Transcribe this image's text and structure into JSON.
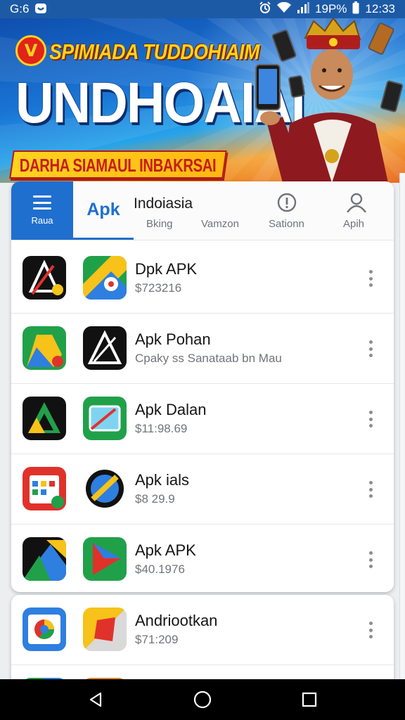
{
  "status_bar": {
    "time_left": "G:6",
    "battery": "19P%",
    "clock": "12:33"
  },
  "banner": {
    "headline_top": "SPIMIADA TUDDOHIAIM",
    "headline_big": "UNDHOAIAI",
    "ribbon_text": "DARHA SIAMAUL INBAKRSAI",
    "logo_letter": "V"
  },
  "tabs": {
    "menu_label": "Raua",
    "apk_label": "Apk",
    "title": "Indoiasia",
    "labels": [
      "Bking",
      "Vamzon",
      "Sationn",
      "Apih"
    ]
  },
  "apps": [
    {
      "title": "Dpk APK",
      "subtitle": "$723216",
      "icon1": "arrow-black-icon",
      "icon2": "maps-green-icon"
    },
    {
      "title": "Apk Pohan",
      "subtitle": "Cpaky ss Sanataab bn Mau",
      "icon1": "drive-green-icon",
      "icon2": "arrow-black-icon"
    },
    {
      "title": "Apk Dalan",
      "subtitle": "$11:98.69",
      "icon1": "drive-black-icon",
      "icon2": "picture-green-icon"
    },
    {
      "title": "Apk ials",
      "subtitle": "$8 29.9",
      "icon1": "calendar-red-icon",
      "icon2": "blocked-yellow-icon"
    },
    {
      "title": "Apk APK",
      "subtitle": "$40.1976",
      "icon1": "drive-blue-icon",
      "icon2": "play-green-icon"
    }
  ],
  "apps_second": [
    {
      "title": "Andriootkan",
      "subtitle": "$71:209",
      "icon1": "chrome-blue-icon",
      "icon2": "bag-yellow-icon"
    }
  ],
  "colors": {
    "accent": "#1f6fcf",
    "status_bar": "#1d5aa6",
    "banner_yellow": "#ffd21f",
    "banner_red": "#c61d16"
  }
}
